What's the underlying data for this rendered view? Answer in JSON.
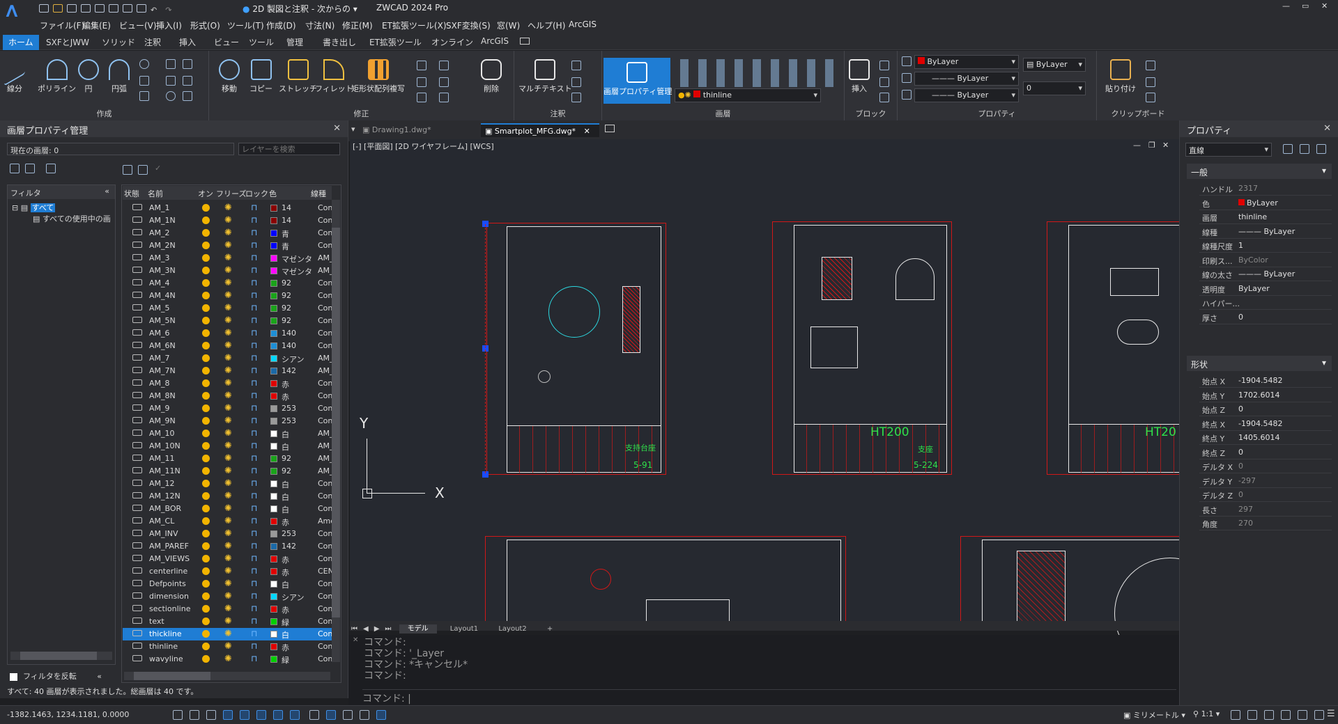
{
  "titlebar": {
    "workspace": "2D 製図と注釈 - 次からの",
    "app_title": "ZWCAD 2024 Pro",
    "min_icon": "minimize-icon",
    "max_icon": "maximize-icon",
    "close_icon": "close-icon"
  },
  "menu": [
    "ファイル(F)",
    "編集(E)",
    "ビュー(V)",
    "挿入(I)",
    "形式(O)",
    "ツール(T)",
    "作成(D)",
    "寸法(N)",
    "修正(M)",
    "ET拡張ツール(X)",
    "SXF変換(S)",
    "窓(W)",
    "ヘルプ(H)",
    "ArcGIS"
  ],
  "ribbon_tabs": [
    "ホーム",
    "SXFとJWW",
    "ソリッド",
    "注釈",
    "挿入",
    "ビュー",
    "ツール",
    "管理",
    "書き出し",
    "ET拡張ツール",
    "オンライン",
    "ArcGIS"
  ],
  "ribbon": {
    "draw": {
      "label": "作成",
      "buttons": [
        "線分",
        "ポリライン",
        "円",
        "円弧"
      ]
    },
    "modify": {
      "label": "修正",
      "buttons": [
        "移動",
        "コピー",
        "ストレッチ",
        "フィレット",
        "矩形状配列複写",
        "削除"
      ]
    },
    "annotation": {
      "label": "注釈",
      "buttons": [
        "マルチテキスト"
      ]
    },
    "layers": {
      "label": "画層",
      "buttons": [
        "画層プロパティ管理"
      ],
      "current_layer": "thinline"
    },
    "block": {
      "label": "ブロック",
      "buttons": [
        "挿入"
      ]
    },
    "properties": {
      "label": "プロパティ",
      "color": "ByLayer",
      "linetype": "ByLayer",
      "lineweight": "ByLayer",
      "plotstyle": "ByLayer",
      "transparency": "0"
    },
    "clipboard": {
      "label": "クリップボード",
      "buttons": [
        "貼り付け"
      ]
    }
  },
  "layer_panel": {
    "title": "画層プロパティ管理",
    "current_layer_label": "現在の画層: 0",
    "search_placeholder": "レイヤーを検索",
    "filter_header": "フィルタ",
    "filter_all": "すべて",
    "filter_used": "すべての使用中の画",
    "invert_filter": "フィルタを反転",
    "columns": [
      "状態",
      "名前",
      "オン",
      "フリーズ",
      "ロック",
      "色",
      "線種"
    ],
    "summary": "すべて: 40 画層が表示されました。総画層は 40 です。",
    "rows": [
      {
        "name": "AM_1",
        "color": "14",
        "swatch": "#8b0000",
        "ltype": "Con"
      },
      {
        "name": "AM_1N",
        "color": "14",
        "swatch": "#8b0000",
        "ltype": "Con"
      },
      {
        "name": "AM_2",
        "color": "青",
        "swatch": "#0000ff",
        "ltype": "Con"
      },
      {
        "name": "AM_2N",
        "color": "青",
        "swatch": "#0000ff",
        "ltype": "Con"
      },
      {
        "name": "AM_3",
        "color": "マゼンタ",
        "swatch": "#ff00ff",
        "ltype": "AM_"
      },
      {
        "name": "AM_3N",
        "color": "マゼンタ",
        "swatch": "#ff00ff",
        "ltype": "AM_"
      },
      {
        "name": "AM_4",
        "color": "92",
        "swatch": "#1aa31a",
        "ltype": "Con"
      },
      {
        "name": "AM_4N",
        "color": "92",
        "swatch": "#1aa31a",
        "ltype": "Con"
      },
      {
        "name": "AM_5",
        "color": "92",
        "swatch": "#1aa31a",
        "ltype": "Con"
      },
      {
        "name": "AM_5N",
        "color": "92",
        "swatch": "#1aa31a",
        "ltype": "Con"
      },
      {
        "name": "AM_6",
        "color": "140",
        "swatch": "#1e8fd6",
        "ltype": "Con"
      },
      {
        "name": "AM_6N",
        "color": "140",
        "swatch": "#1e8fd6",
        "ltype": "Con"
      },
      {
        "name": "AM_7",
        "color": "シアン",
        "swatch": "#00d8ff",
        "ltype": "AM_"
      },
      {
        "name": "AM_7N",
        "color": "142",
        "swatch": "#1b6aa8",
        "ltype": "AM_"
      },
      {
        "name": "AM_8",
        "color": "赤",
        "swatch": "#e00000",
        "ltype": "Con"
      },
      {
        "name": "AM_8N",
        "color": "赤",
        "swatch": "#e00000",
        "ltype": "Con"
      },
      {
        "name": "AM_9",
        "color": "253",
        "swatch": "#9a9a9a",
        "ltype": "Con"
      },
      {
        "name": "AM_9N",
        "color": "253",
        "swatch": "#9a9a9a",
        "ltype": "Con"
      },
      {
        "name": "AM_10",
        "color": "白",
        "swatch": "#ffffff",
        "ltype": "AM_"
      },
      {
        "name": "AM_10N",
        "color": "白",
        "swatch": "#ffffff",
        "ltype": "AM_"
      },
      {
        "name": "AM_11",
        "color": "92",
        "swatch": "#1aa31a",
        "ltype": "AM_"
      },
      {
        "name": "AM_11N",
        "color": "92",
        "swatch": "#1aa31a",
        "ltype": "AM_"
      },
      {
        "name": "AM_12",
        "color": "白",
        "swatch": "#ffffff",
        "ltype": "Con"
      },
      {
        "name": "AM_12N",
        "color": "白",
        "swatch": "#ffffff",
        "ltype": "Con"
      },
      {
        "name": "AM_BOR",
        "color": "白",
        "swatch": "#ffffff",
        "ltype": "Con"
      },
      {
        "name": "AM_CL",
        "color": "赤",
        "swatch": "#e00000",
        "ltype": "Amc"
      },
      {
        "name": "AM_INV",
        "color": "253",
        "swatch": "#9a9a9a",
        "ltype": "Con"
      },
      {
        "name": "AM_PAREF",
        "color": "142",
        "swatch": "#1b6aa8",
        "ltype": "Con"
      },
      {
        "name": "AM_VIEWS",
        "color": "赤",
        "swatch": "#e00000",
        "ltype": "Con"
      },
      {
        "name": "centerline",
        "color": "赤",
        "swatch": "#e00000",
        "ltype": "CEN"
      },
      {
        "name": "Defpoints",
        "color": "白",
        "swatch": "#ffffff",
        "ltype": "Con"
      },
      {
        "name": "dimension",
        "color": "シアン",
        "swatch": "#00d8ff",
        "ltype": "Con"
      },
      {
        "name": "sectionline",
        "color": "赤",
        "swatch": "#e00000",
        "ltype": "Con"
      },
      {
        "name": "text",
        "color": "緑",
        "swatch": "#00d000",
        "ltype": "Con"
      },
      {
        "name": "thickline",
        "color": "白",
        "swatch": "#ffffff",
        "ltype": "Con",
        "selected": true
      },
      {
        "name": "thinline",
        "color": "赤",
        "swatch": "#e00000",
        "ltype": "Con"
      },
      {
        "name": "wavyline",
        "color": "緑",
        "swatch": "#00d000",
        "ltype": "Con"
      }
    ]
  },
  "doc_tabs": [
    "Drawing1.dwg*",
    "Smartplot_MFG.dwg*"
  ],
  "viewport_label": "[-] [平面図] [2D ワイヤフレーム] [WCS]",
  "layout_tabs": [
    "モデル",
    "Layout1",
    "Layout2",
    "+"
  ],
  "drawing": {
    "sheet1_text": "支持台座",
    "sheet1_num": "5-91",
    "sheet2_title": "HT200",
    "sheet2_text": "支座",
    "sheet2_num": "5-224",
    "sheet3_title": "HT20",
    "axis_x": "X",
    "axis_y": "Y"
  },
  "command": {
    "lines": [
      "コマンド:",
      "コマンド: '_Layer",
      "コマンド: *キャンセル*",
      "コマンド:"
    ],
    "prompt": "コマンド:"
  },
  "properties_panel": {
    "title": "プロパティ",
    "object_type": "直線",
    "general_label": "一般",
    "geometry_label": "形状",
    "general": [
      {
        "k": "ハンドル",
        "v": "2317",
        "dim": true
      },
      {
        "k": "色",
        "v": "ByLayer",
        "swatch": "#e00000"
      },
      {
        "k": "画層",
        "v": "thinline"
      },
      {
        "k": "線種",
        "v": "——— ByLayer"
      },
      {
        "k": "線種尺度",
        "v": "1"
      },
      {
        "k": "印刷ス...",
        "v": "ByColor",
        "dim": true
      },
      {
        "k": "線の太さ",
        "v": "——— ByLayer"
      },
      {
        "k": "透明度",
        "v": "ByLayer"
      },
      {
        "k": "ハイパー...",
        "v": ""
      },
      {
        "k": "厚さ",
        "v": "0"
      }
    ],
    "geometry": [
      {
        "k": "始点 X",
        "v": "-1904.5482"
      },
      {
        "k": "始点 Y",
        "v": "1702.6014"
      },
      {
        "k": "始点 Z",
        "v": "0"
      },
      {
        "k": "終点 X",
        "v": "-1904.5482"
      },
      {
        "k": "終点 Y",
        "v": "1405.6014"
      },
      {
        "k": "終点 Z",
        "v": "0"
      },
      {
        "k": "デルタ X",
        "v": "0",
        "dim": true
      },
      {
        "k": "デルタ Y",
        "v": "-297",
        "dim": true
      },
      {
        "k": "デルタ Z",
        "v": "0",
        "dim": true
      },
      {
        "k": "長さ",
        "v": "297",
        "dim": true
      },
      {
        "k": "角度",
        "v": "270",
        "dim": true
      }
    ]
  },
  "status": {
    "coords": "-1382.1463, 1234.1181, 0.0000",
    "units": "ミリメートル",
    "scale": "1:1"
  }
}
